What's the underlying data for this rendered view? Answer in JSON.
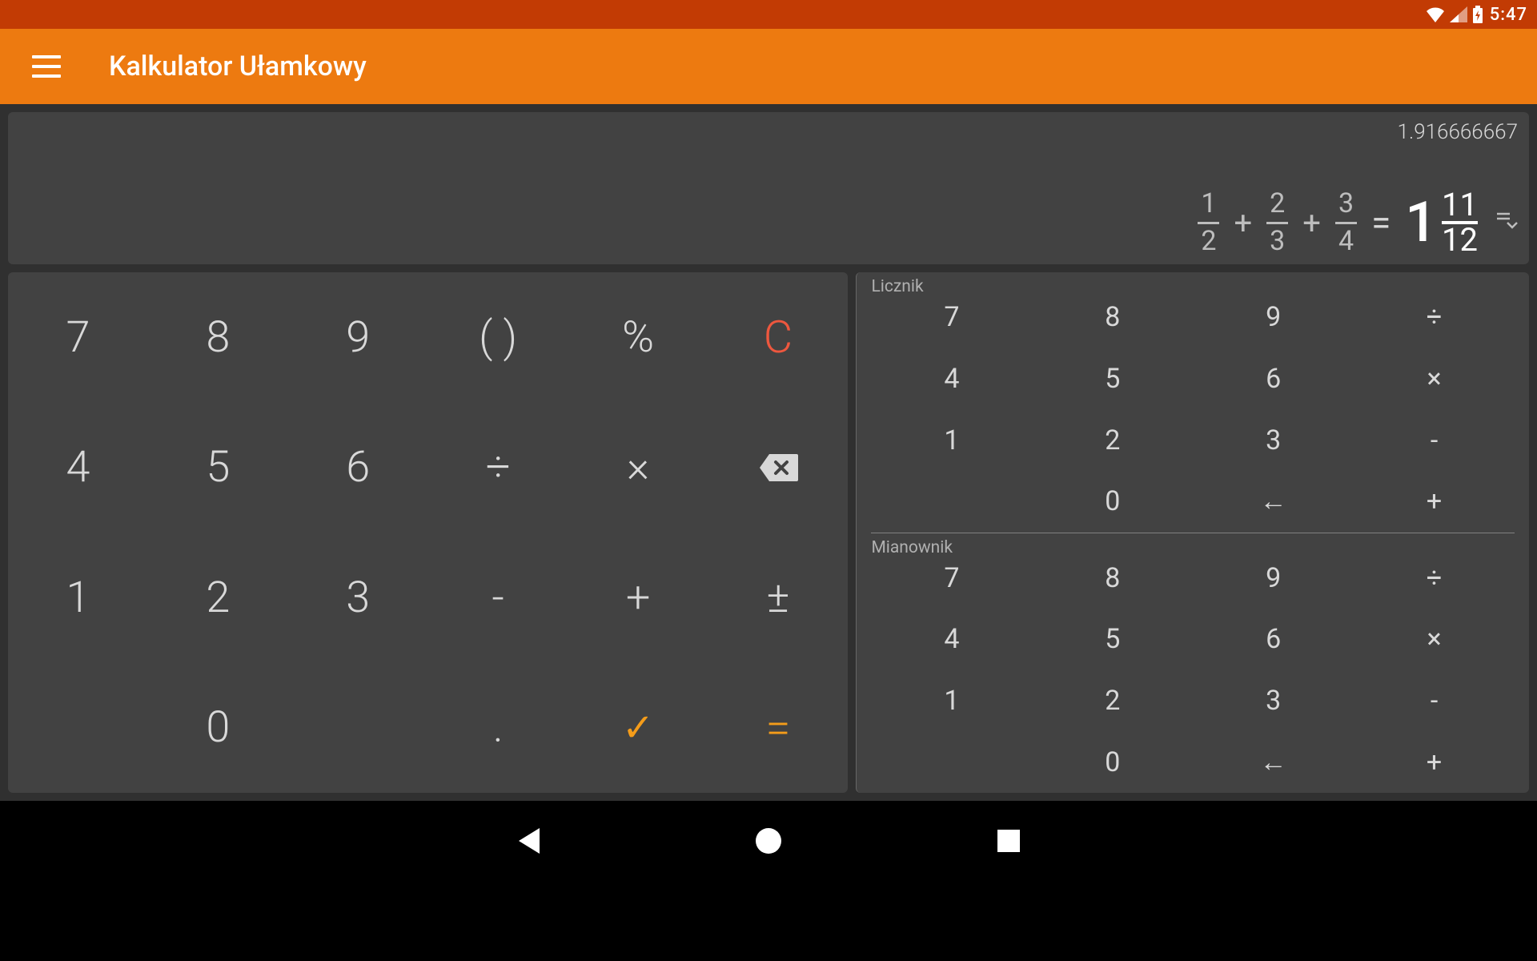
{
  "status": {
    "time": "5:47"
  },
  "header": {
    "title": "Kalkulator Ułamkowy"
  },
  "display": {
    "decimal": "1.916666667",
    "terms": [
      {
        "num": "1",
        "den": "2"
      },
      {
        "op": "+"
      },
      {
        "num": "2",
        "den": "3"
      },
      {
        "op": "+"
      },
      {
        "num": "3",
        "den": "4"
      }
    ],
    "eq": "=",
    "result": {
      "whole": "1",
      "num": "11",
      "den": "12"
    }
  },
  "keypad_left": {
    "r1": [
      "7",
      "8",
      "9",
      "( )",
      "%",
      "C"
    ],
    "r2": [
      "4",
      "5",
      "6",
      "÷",
      "×",
      ""
    ],
    "r3": [
      "1",
      "2",
      "3",
      "-",
      "+",
      "±"
    ],
    "r4": [
      "",
      "0",
      "",
      ".",
      "✓",
      "="
    ]
  },
  "numerator": {
    "label": "Licznik",
    "rows": [
      [
        "7",
        "8",
        "9",
        "÷"
      ],
      [
        "4",
        "5",
        "6",
        "×"
      ],
      [
        "1",
        "2",
        "3",
        "-"
      ],
      [
        "",
        "0",
        "←",
        "+"
      ]
    ]
  },
  "denominator": {
    "label": "Mianownik",
    "rows": [
      [
        "7",
        "8",
        "9",
        "÷"
      ],
      [
        "4",
        "5",
        "6",
        "×"
      ],
      [
        "1",
        "2",
        "3",
        "-"
      ],
      [
        "",
        "0",
        "←",
        "+"
      ]
    ]
  }
}
